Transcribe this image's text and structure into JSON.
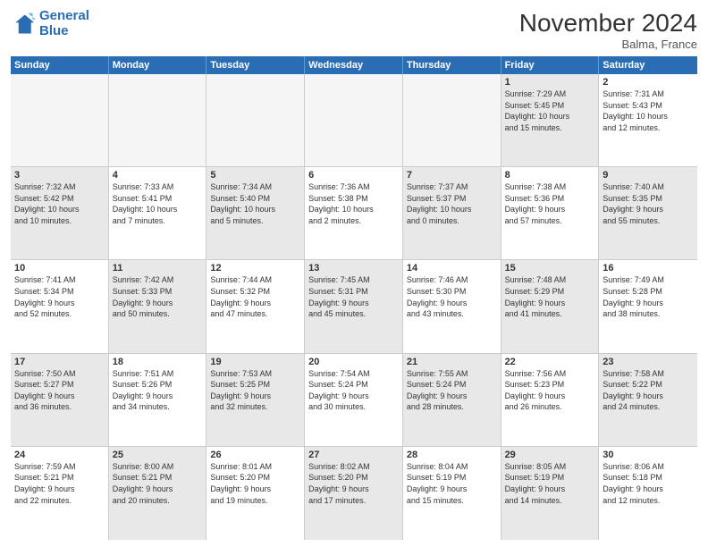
{
  "logo": {
    "line1": "General",
    "line2": "Blue"
  },
  "title": "November 2024",
  "location": "Balma, France",
  "header_days": [
    "Sunday",
    "Monday",
    "Tuesday",
    "Wednesday",
    "Thursday",
    "Friday",
    "Saturday"
  ],
  "weeks": [
    [
      {
        "day": "",
        "info": "",
        "empty": true
      },
      {
        "day": "",
        "info": "",
        "empty": true
      },
      {
        "day": "",
        "info": "",
        "empty": true
      },
      {
        "day": "",
        "info": "",
        "empty": true
      },
      {
        "day": "",
        "info": "",
        "empty": true
      },
      {
        "day": "1",
        "info": "Sunrise: 7:29 AM\nSunset: 5:45 PM\nDaylight: 10 hours\nand 15 minutes.",
        "empty": false,
        "shaded": true
      },
      {
        "day": "2",
        "info": "Sunrise: 7:31 AM\nSunset: 5:43 PM\nDaylight: 10 hours\nand 12 minutes.",
        "empty": false,
        "shaded": false
      }
    ],
    [
      {
        "day": "3",
        "info": "Sunrise: 7:32 AM\nSunset: 5:42 PM\nDaylight: 10 hours\nand 10 minutes.",
        "empty": false,
        "shaded": true
      },
      {
        "day": "4",
        "info": "Sunrise: 7:33 AM\nSunset: 5:41 PM\nDaylight: 10 hours\nand 7 minutes.",
        "empty": false,
        "shaded": false
      },
      {
        "day": "5",
        "info": "Sunrise: 7:34 AM\nSunset: 5:40 PM\nDaylight: 10 hours\nand 5 minutes.",
        "empty": false,
        "shaded": true
      },
      {
        "day": "6",
        "info": "Sunrise: 7:36 AM\nSunset: 5:38 PM\nDaylight: 10 hours\nand 2 minutes.",
        "empty": false,
        "shaded": false
      },
      {
        "day": "7",
        "info": "Sunrise: 7:37 AM\nSunset: 5:37 PM\nDaylight: 10 hours\nand 0 minutes.",
        "empty": false,
        "shaded": true
      },
      {
        "day": "8",
        "info": "Sunrise: 7:38 AM\nSunset: 5:36 PM\nDaylight: 9 hours\nand 57 minutes.",
        "empty": false,
        "shaded": false
      },
      {
        "day": "9",
        "info": "Sunrise: 7:40 AM\nSunset: 5:35 PM\nDaylight: 9 hours\nand 55 minutes.",
        "empty": false,
        "shaded": true
      }
    ],
    [
      {
        "day": "10",
        "info": "Sunrise: 7:41 AM\nSunset: 5:34 PM\nDaylight: 9 hours\nand 52 minutes.",
        "empty": false,
        "shaded": false
      },
      {
        "day": "11",
        "info": "Sunrise: 7:42 AM\nSunset: 5:33 PM\nDaylight: 9 hours\nand 50 minutes.",
        "empty": false,
        "shaded": true
      },
      {
        "day": "12",
        "info": "Sunrise: 7:44 AM\nSunset: 5:32 PM\nDaylight: 9 hours\nand 47 minutes.",
        "empty": false,
        "shaded": false
      },
      {
        "day": "13",
        "info": "Sunrise: 7:45 AM\nSunset: 5:31 PM\nDaylight: 9 hours\nand 45 minutes.",
        "empty": false,
        "shaded": true
      },
      {
        "day": "14",
        "info": "Sunrise: 7:46 AM\nSunset: 5:30 PM\nDaylight: 9 hours\nand 43 minutes.",
        "empty": false,
        "shaded": false
      },
      {
        "day": "15",
        "info": "Sunrise: 7:48 AM\nSunset: 5:29 PM\nDaylight: 9 hours\nand 41 minutes.",
        "empty": false,
        "shaded": true
      },
      {
        "day": "16",
        "info": "Sunrise: 7:49 AM\nSunset: 5:28 PM\nDaylight: 9 hours\nand 38 minutes.",
        "empty": false,
        "shaded": false
      }
    ],
    [
      {
        "day": "17",
        "info": "Sunrise: 7:50 AM\nSunset: 5:27 PM\nDaylight: 9 hours\nand 36 minutes.",
        "empty": false,
        "shaded": true
      },
      {
        "day": "18",
        "info": "Sunrise: 7:51 AM\nSunset: 5:26 PM\nDaylight: 9 hours\nand 34 minutes.",
        "empty": false,
        "shaded": false
      },
      {
        "day": "19",
        "info": "Sunrise: 7:53 AM\nSunset: 5:25 PM\nDaylight: 9 hours\nand 32 minutes.",
        "empty": false,
        "shaded": true
      },
      {
        "day": "20",
        "info": "Sunrise: 7:54 AM\nSunset: 5:24 PM\nDaylight: 9 hours\nand 30 minutes.",
        "empty": false,
        "shaded": false
      },
      {
        "day": "21",
        "info": "Sunrise: 7:55 AM\nSunset: 5:24 PM\nDaylight: 9 hours\nand 28 minutes.",
        "empty": false,
        "shaded": true
      },
      {
        "day": "22",
        "info": "Sunrise: 7:56 AM\nSunset: 5:23 PM\nDaylight: 9 hours\nand 26 minutes.",
        "empty": false,
        "shaded": false
      },
      {
        "day": "23",
        "info": "Sunrise: 7:58 AM\nSunset: 5:22 PM\nDaylight: 9 hours\nand 24 minutes.",
        "empty": false,
        "shaded": true
      }
    ],
    [
      {
        "day": "24",
        "info": "Sunrise: 7:59 AM\nSunset: 5:21 PM\nDaylight: 9 hours\nand 22 minutes.",
        "empty": false,
        "shaded": false
      },
      {
        "day": "25",
        "info": "Sunrise: 8:00 AM\nSunset: 5:21 PM\nDaylight: 9 hours\nand 20 minutes.",
        "empty": false,
        "shaded": true
      },
      {
        "day": "26",
        "info": "Sunrise: 8:01 AM\nSunset: 5:20 PM\nDaylight: 9 hours\nand 19 minutes.",
        "empty": false,
        "shaded": false
      },
      {
        "day": "27",
        "info": "Sunrise: 8:02 AM\nSunset: 5:20 PM\nDaylight: 9 hours\nand 17 minutes.",
        "empty": false,
        "shaded": true
      },
      {
        "day": "28",
        "info": "Sunrise: 8:04 AM\nSunset: 5:19 PM\nDaylight: 9 hours\nand 15 minutes.",
        "empty": false,
        "shaded": false
      },
      {
        "day": "29",
        "info": "Sunrise: 8:05 AM\nSunset: 5:19 PM\nDaylight: 9 hours\nand 14 minutes.",
        "empty": false,
        "shaded": true
      },
      {
        "day": "30",
        "info": "Sunrise: 8:06 AM\nSunset: 5:18 PM\nDaylight: 9 hours\nand 12 minutes.",
        "empty": false,
        "shaded": false
      }
    ]
  ]
}
